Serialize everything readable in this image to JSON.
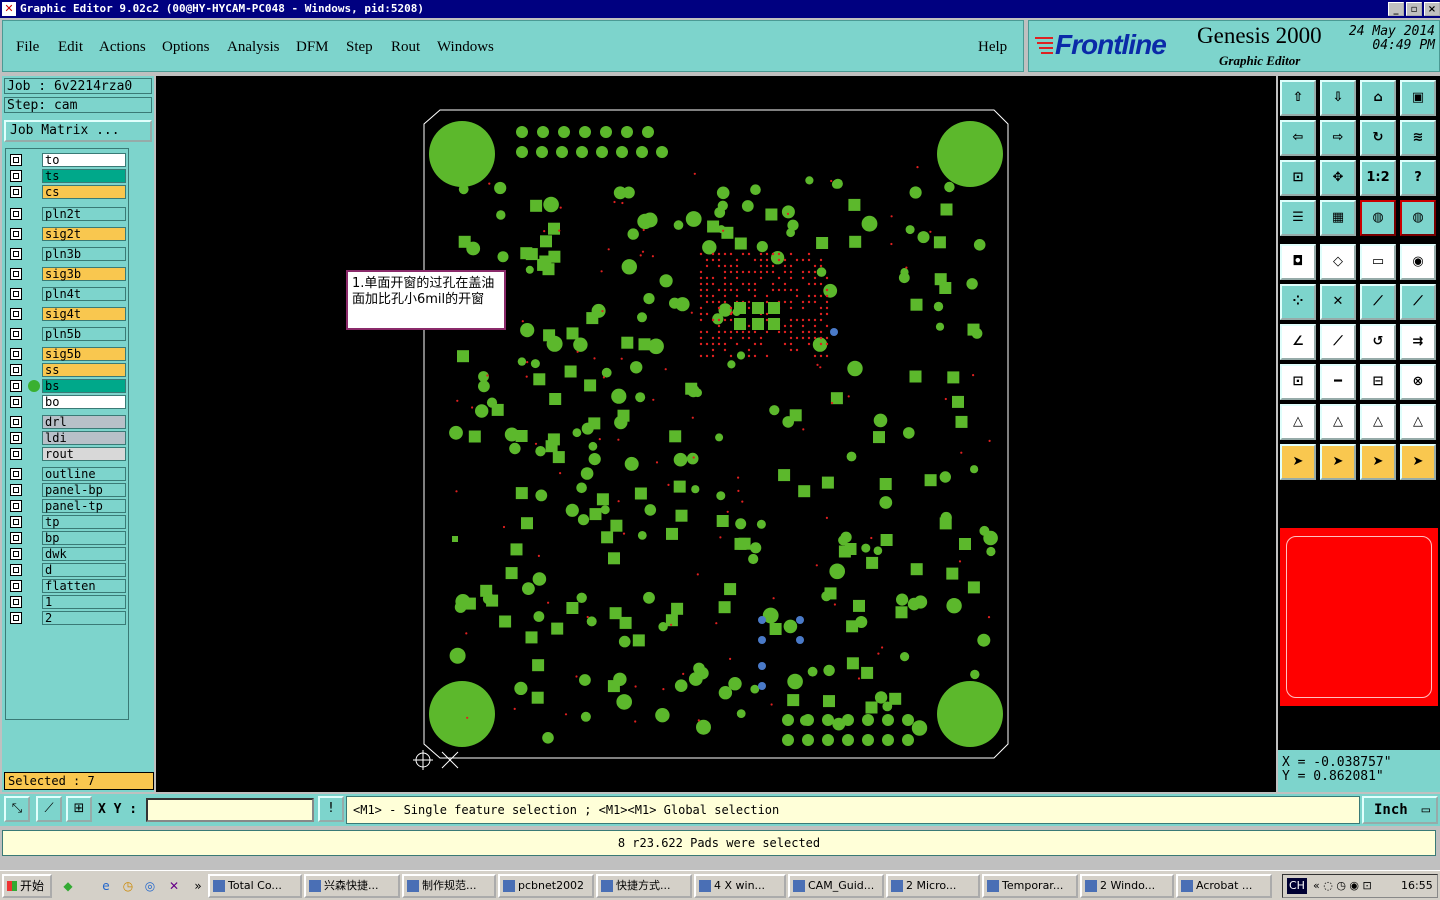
{
  "window": {
    "title": "Graphic Editor 9.02c2  (00@HY-HYCAM-PC048 - Windows, pid:5208)"
  },
  "menu": [
    "File",
    "Edit",
    "Actions",
    "Options",
    "Analysis",
    "DFM",
    "Step",
    "Rout",
    "Windows"
  ],
  "help_label": "Help",
  "brand": {
    "logo": "Frontline",
    "product": "Genesis 2000",
    "subtitle": "Graphic Editor",
    "date": "24 May 2014",
    "time": "04:49 PM"
  },
  "job": {
    "job_text": "Job : 6v2214rza0",
    "step_text": "Step: cam",
    "job_matrix_label": "Job Matrix ..."
  },
  "layers": [
    {
      "name": "to",
      "color": "#ffffff",
      "arrow": false
    },
    {
      "name": "ts",
      "color": "#00a88a",
      "arrow": false
    },
    {
      "name": "cs",
      "color": "#f9c74f",
      "arrow": false
    },
    {
      "name": "pln2t",
      "color": "#7dd4cc",
      "arrow": false
    },
    {
      "name": "sig2t",
      "color": "#f9c74f",
      "arrow": true
    },
    {
      "name": "pln3b",
      "color": "#7dd4cc",
      "arrow": false
    },
    {
      "name": "sig3b",
      "color": "#f9c74f",
      "arrow": true
    },
    {
      "name": "pln4t",
      "color": "#7dd4cc",
      "arrow": false
    },
    {
      "name": "sig4t",
      "color": "#f9c74f",
      "arrow": true
    },
    {
      "name": "pln5b",
      "color": "#7dd4cc",
      "arrow": false
    },
    {
      "name": "sig5b",
      "color": "#f9c74f",
      "arrow": true
    },
    {
      "name": "ss",
      "color": "#f9c74f",
      "arrow": false
    },
    {
      "name": "bs",
      "color": "#00a88a",
      "arrow": false
    },
    {
      "name": "bo",
      "color": "#ffffff",
      "arrow": false
    },
    {
      "name": "drl",
      "color": "#b8c0c8",
      "arrow": false
    },
    {
      "name": "ldi",
      "color": "#b8c0c8",
      "arrow": false
    },
    {
      "name": "rout",
      "color": "#d8d8d8",
      "arrow": false
    },
    {
      "name": "outline",
      "color": "#7dd4cc",
      "arrow": false
    },
    {
      "name": "panel-bp",
      "color": "#7dd4cc",
      "arrow": false
    },
    {
      "name": "panel-tp",
      "color": "#7dd4cc",
      "arrow": false
    },
    {
      "name": "tp",
      "color": "#7dd4cc",
      "arrow": false
    },
    {
      "name": "bp",
      "color": "#7dd4cc",
      "arrow": false
    },
    {
      "name": "dwk",
      "color": "#7dd4cc",
      "arrow": false
    },
    {
      "name": "d",
      "color": "#7dd4cc",
      "arrow": false
    },
    {
      "name": "flatten",
      "color": "#7dd4cc",
      "arrow": false
    },
    {
      "name": "1",
      "color": "#7dd4cc",
      "arrow": false
    },
    {
      "name": "2",
      "color": "#7dd4cc",
      "arrow": false
    }
  ],
  "selected_text": "Selected : 7",
  "callout_text": "1.单面开窗的过孔在盖油面加比孔小6mil的开窗",
  "coords": {
    "x_text": "X = -0.038757\"",
    "y_text": "Y = 0.862081\""
  },
  "command": {
    "xy_label": "X Y :",
    "xy_value": "",
    "hint": "<M1> - Single feature selection ; <M1><M1> Global selection",
    "unit": "Inch"
  },
  "status_message": "8 r23.622 Pads were selected",
  "toolbox_labels": [
    "1:2",
    "?"
  ],
  "taskbar": {
    "start": "开始",
    "tasks": [
      "Total Co...",
      "兴森快捷...",
      "制作规范...",
      "pcbnet2002",
      "快捷方式...",
      "4 X win...",
      "CAM_Guid...",
      "2 Micro...",
      "Temporar...",
      "2 Windo...",
      "Acrobat ..."
    ],
    "lang": "CH",
    "clock": "16:55"
  },
  "colors": {
    "panel": "#7dd4cc",
    "pad_green": "#5cb82c",
    "via_red": "#e02020",
    "board_outline": "#ffffff"
  }
}
